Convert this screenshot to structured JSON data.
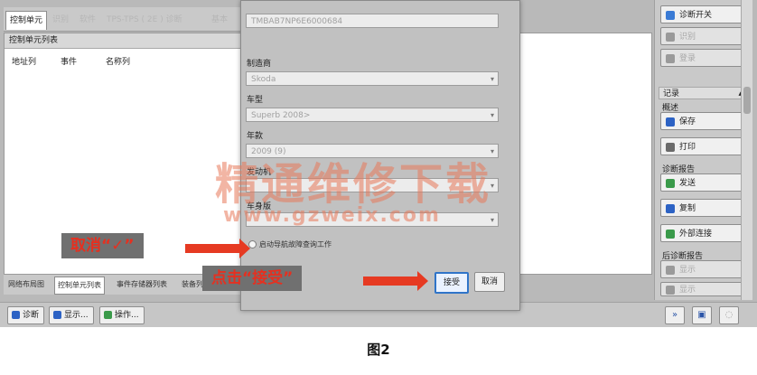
{
  "top_tabs": [
    {
      "label": "控制单元",
      "active": true
    },
    {
      "label": "识别",
      "active": false
    },
    {
      "label": "软件",
      "active": false
    },
    {
      "label": "TPS-TPS ( 2E ) 诊断",
      "active": false
    },
    {
      "label": "基本",
      "active": false
    }
  ],
  "left_panel": {
    "title": "控制单元列表",
    "columns": [
      "地址列",
      "事件",
      "名称列"
    ]
  },
  "bottom_tabs": [
    {
      "label": "网络布局图",
      "active": false
    },
    {
      "label": "控制单元列表",
      "active": true
    },
    {
      "label": "事件存储器列表",
      "active": false
    },
    {
      "label": "装备列",
      "active": false
    }
  ],
  "toolbar": {
    "stop": "诊断",
    "display": "显示...",
    "operate": "操作..."
  },
  "sidebar": {
    "top_buttons": [
      {
        "label": "诊断开关",
        "dim": false,
        "color": "#3a7bd5"
      },
      {
        "label": "识别",
        "dim": true,
        "color": "#9a9a9a"
      },
      {
        "label": "登录",
        "dim": true,
        "color": "#9a9a9a"
      }
    ],
    "record_header": "记录",
    "overview_label": "概述",
    "record_buttons": [
      {
        "label": "保存",
        "color": "#2c62c4"
      },
      {
        "label": "打印",
        "color": "#6a6a6a"
      }
    ],
    "diag_label": "诊断报告",
    "diag_buttons": [
      {
        "label": "发送",
        "color": "#3a9a4a"
      },
      {
        "label": "复制",
        "color": "#2c62c4"
      },
      {
        "label": "外部连接",
        "color": "#3a9a4a"
      }
    ],
    "later_label": "后诊断报告",
    "later_buttons": [
      {
        "label": "显示",
        "color": "#9a9a9a"
      },
      {
        "label": "显示",
        "color": "#9a9a9a"
      }
    ]
  },
  "dialog": {
    "vin_value": "TMBAB7NP6E6000684",
    "maker_label": "制造商",
    "maker_value": "Skoda",
    "model_label": "车型",
    "model_value": "Superb 2008>",
    "year_label": "年款",
    "year_value": "2009 (9)",
    "engine_label": "发动机",
    "engine_value": "",
    "version_label": "车身版",
    "version_value": "",
    "checkbox_label": "启动导航故障查询工作",
    "accept": "接受",
    "cancel": "取消"
  },
  "watermark": {
    "line1": "精通维修下载",
    "line2": "www.gzweix.com"
  },
  "annotations": {
    "uncheck": "取消“✓”",
    "click_accept": "点击“接受”"
  },
  "caption": "图2"
}
